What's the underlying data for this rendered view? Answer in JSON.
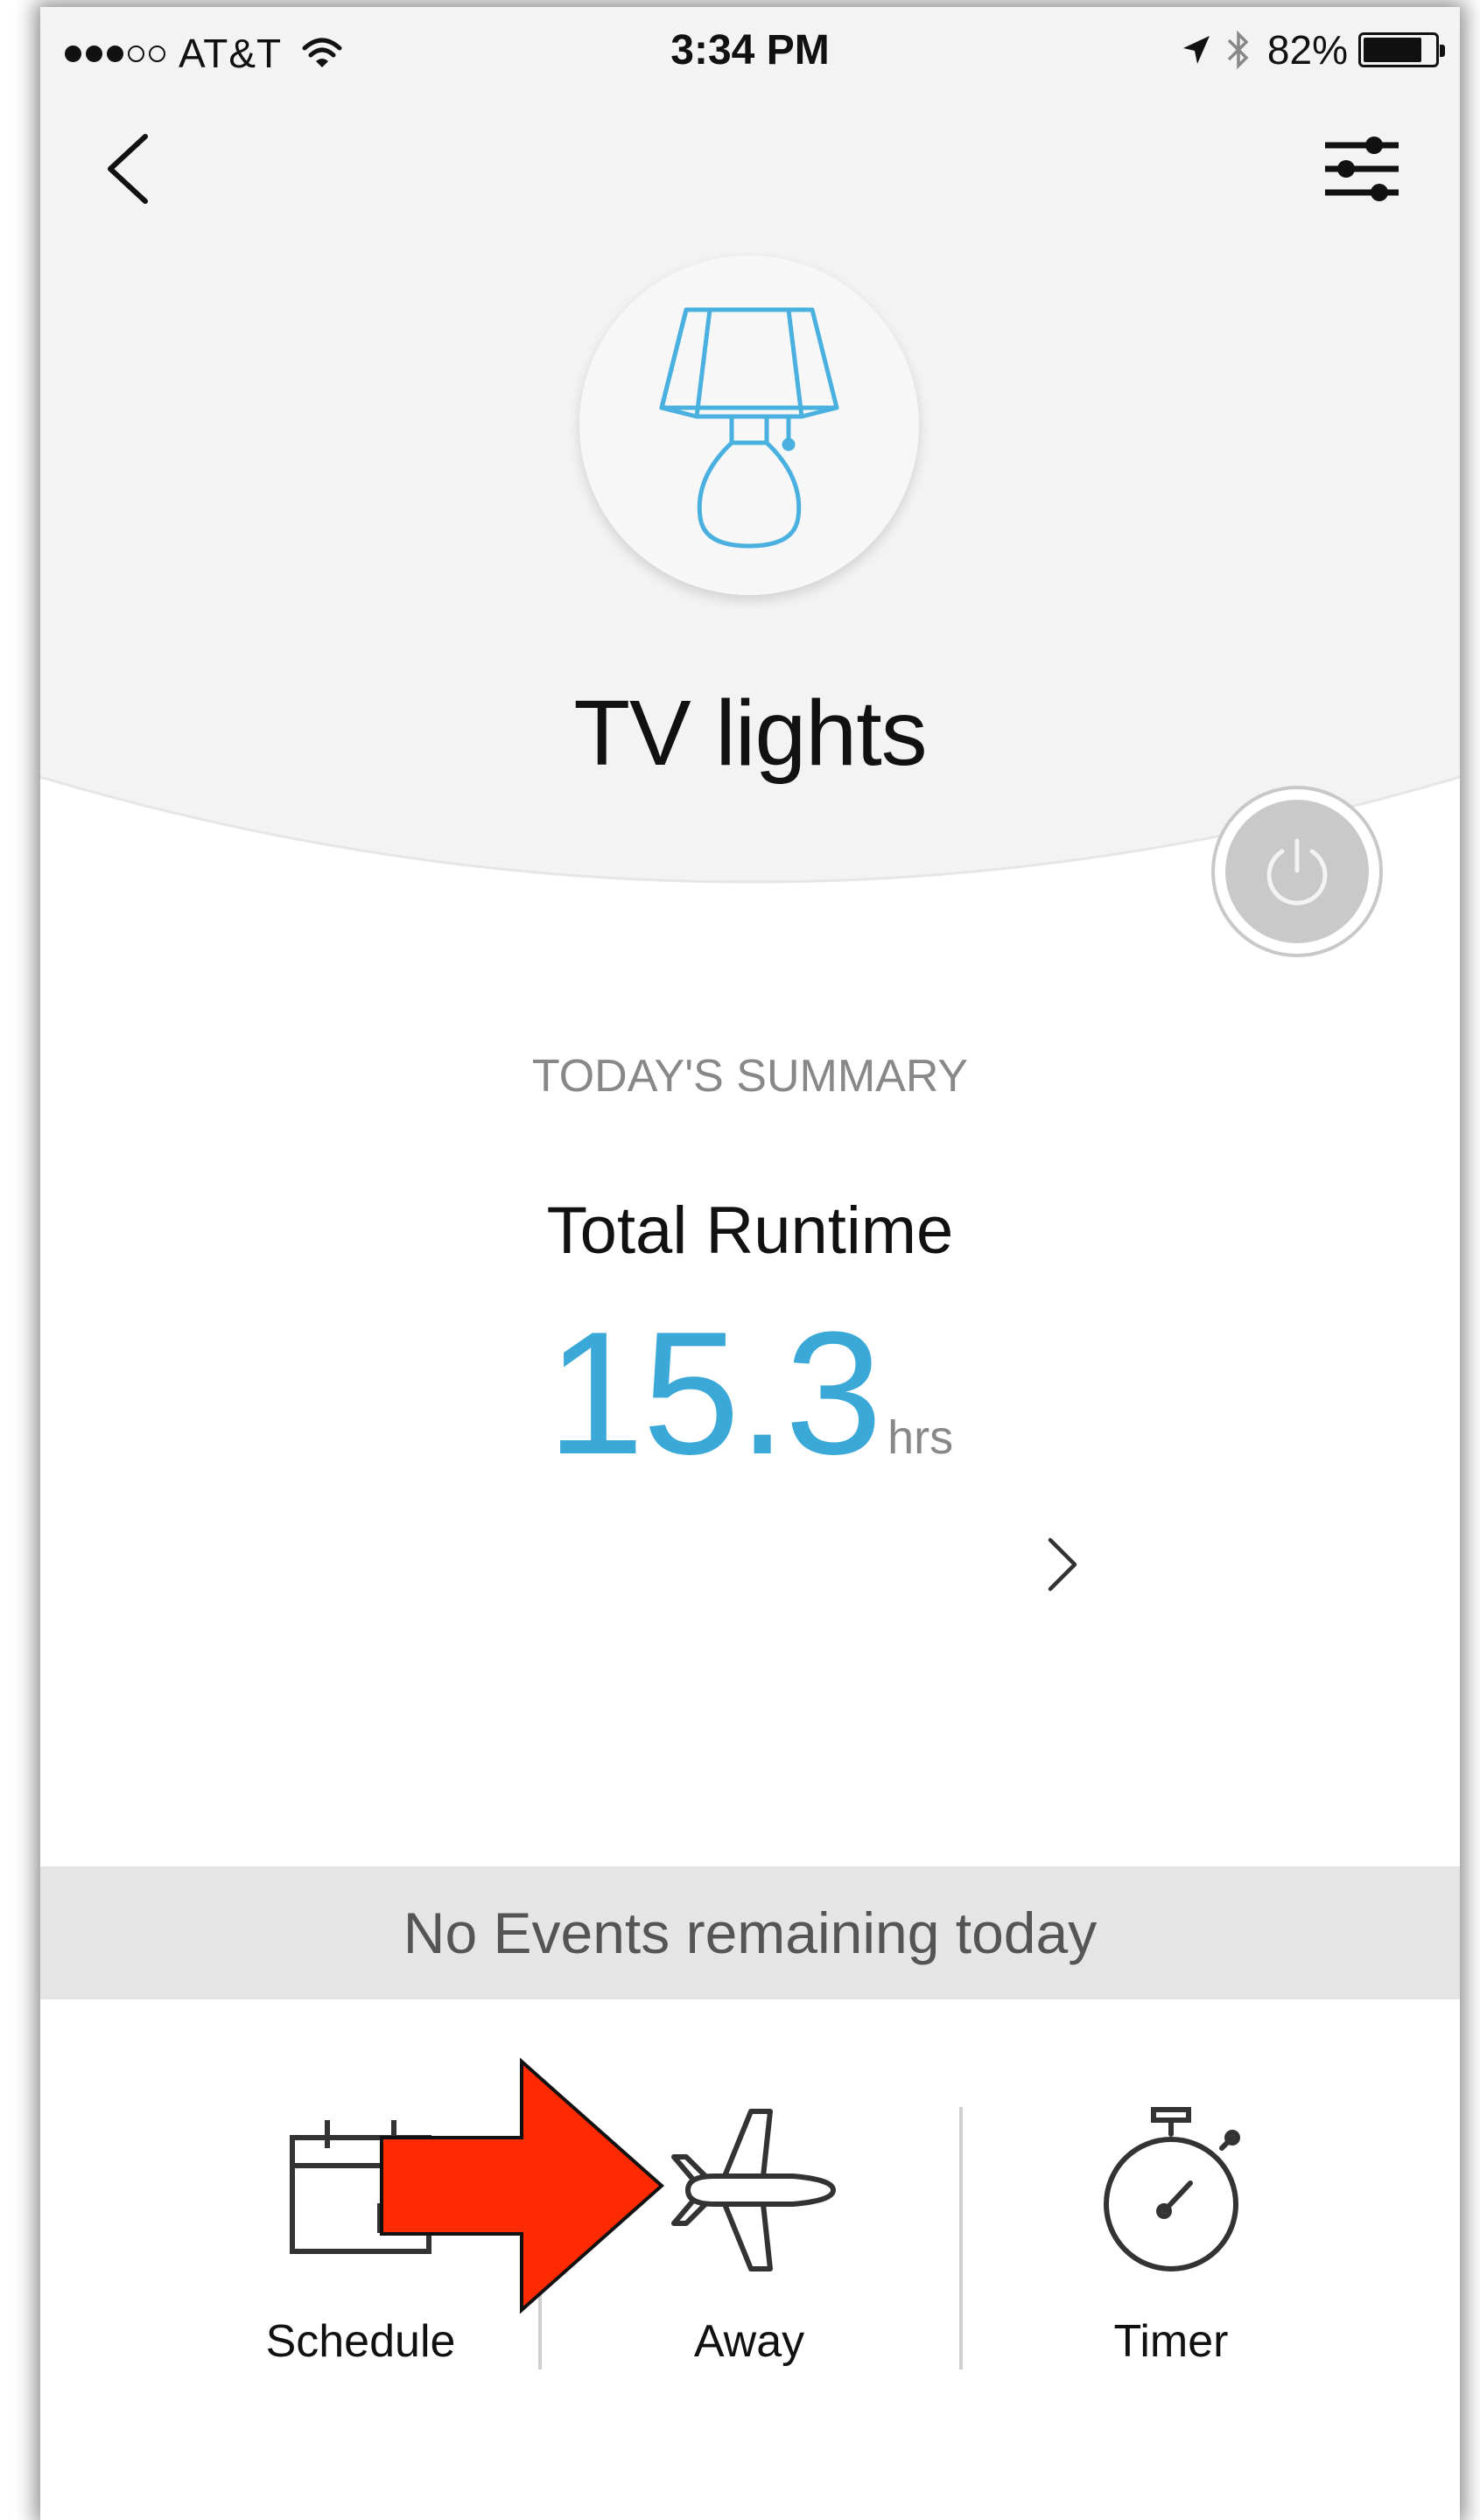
{
  "status_bar": {
    "carrier": "AT&T",
    "time": "3:34 PM",
    "battery_percent": "82%",
    "battery_level": 0.82,
    "signal_bars_on": 3,
    "signal_bars_total": 5
  },
  "nav": {
    "back_icon": "chevron-left-icon",
    "settings_icon": "sliders-icon"
  },
  "device": {
    "name": "TV lights",
    "icon": "lamp-icon",
    "power_state": "off"
  },
  "summary": {
    "heading": "TODAY'S SUMMARY",
    "runtime_label": "Total Runtime",
    "runtime_value": "15.3",
    "runtime_unit": "hrs"
  },
  "events": {
    "message": "No Events remaining today"
  },
  "actions": [
    {
      "label": "Schedule",
      "icon": "calendar-icon"
    },
    {
      "label": "Away",
      "icon": "airplane-icon"
    },
    {
      "label": "Timer",
      "icon": "stopwatch-icon"
    }
  ],
  "colors": {
    "accent": "#3ba9d8",
    "header_bg": "#f3f3f3",
    "events_bar_bg": "#e5e5e5",
    "annotation_arrow": "#ff2a00"
  }
}
